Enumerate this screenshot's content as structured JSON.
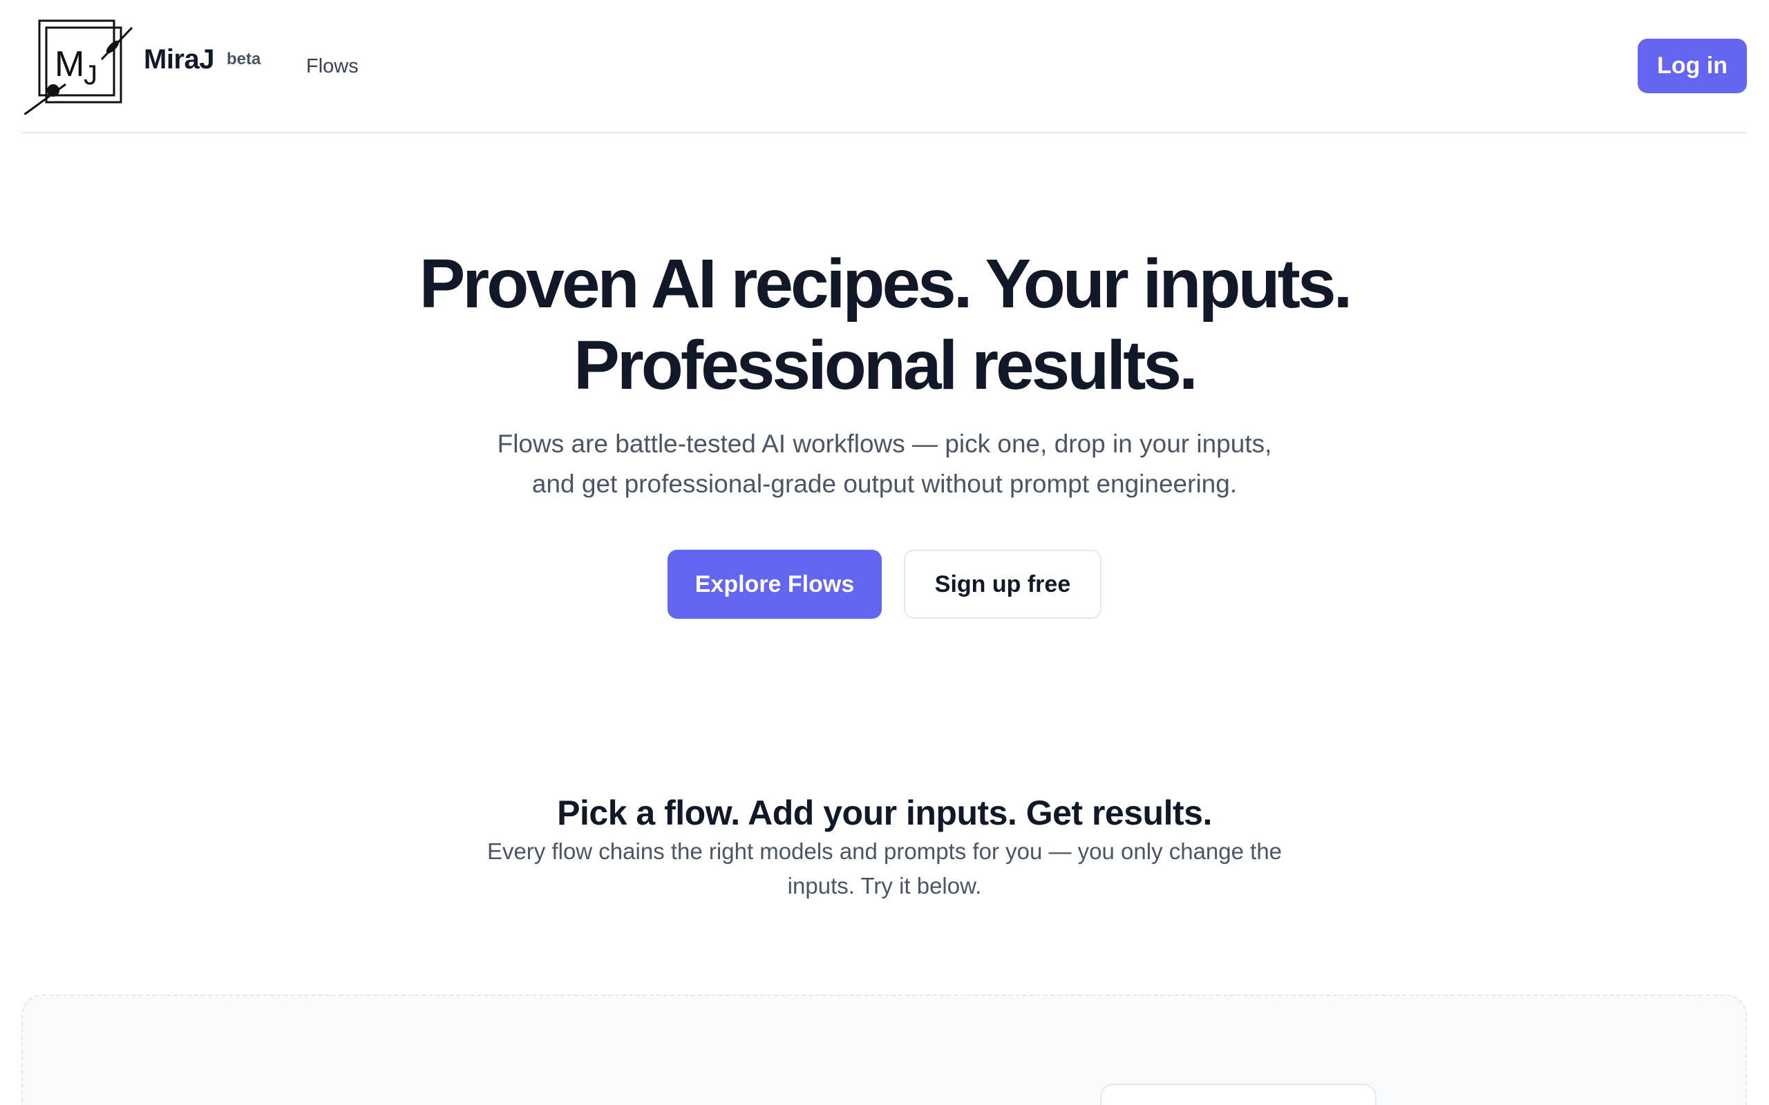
{
  "header": {
    "logo_label": "MJ",
    "brand": "MiraJ",
    "badge": "beta",
    "nav_flows": "Flows",
    "login": "Log in"
  },
  "hero": {
    "title_line1": "Proven AI recipes. Your inputs.",
    "title_line2": "Professional results.",
    "sub_line1": "Flows are battle-tested AI workflows — pick one, drop in your inputs,",
    "sub_line2": "and get professional-grade output without prompt engineering.",
    "primary_cta": "Explore Flows",
    "secondary_cta": "Sign up free"
  },
  "section": {
    "title": "Pick a flow. Add your inputs. Get results.",
    "sub_line1": "Every flow chains the right models and prompts for you — you only change the",
    "sub_line2": "inputs. Try it below."
  },
  "colors": {
    "accent": "#6366f1",
    "text": "#111827",
    "muted": "#4b5563",
    "border": "#e5e7eb"
  }
}
